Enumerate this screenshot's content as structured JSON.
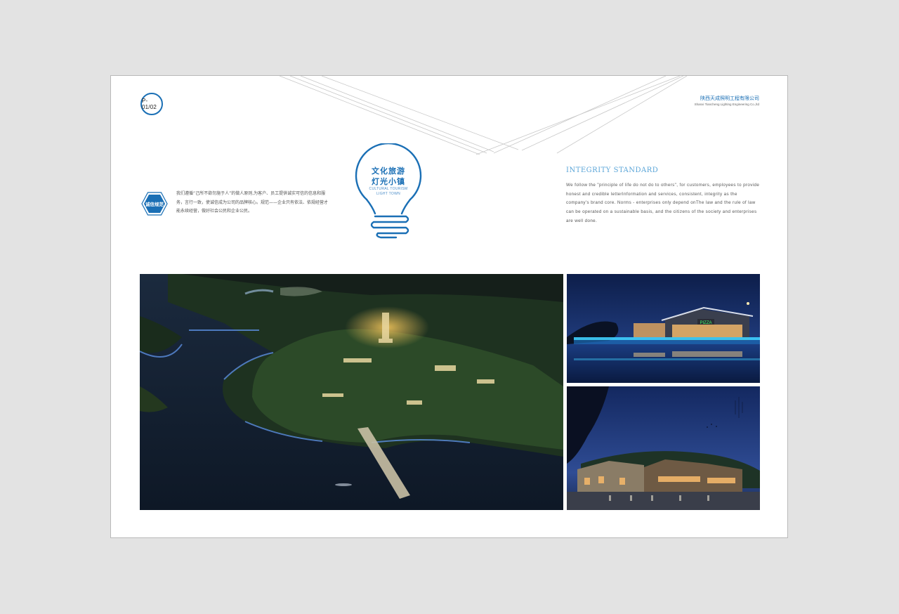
{
  "page_number": "P-01/02",
  "company": {
    "name_cn": "陕西天成照明工程有限公司",
    "name_en": "Shanxi Tiancheng Lighting Engineering Co.,ltd"
  },
  "logo": {
    "title_line1": "文化旅游",
    "title_line2": "灯光小镇",
    "subtitle_line1": "CULTURAL TOURISM",
    "subtitle_line2": "LIGHT TOWN",
    "icon": "lightbulb-icon"
  },
  "integrity_badge": {
    "label": "诚信规范",
    "color": "#1a6fb5"
  },
  "cn_paragraph": "我们遵循“己所不欲勿施于人”的做人原则,为客户、员工提供诚实可信的信息和服务，言行一致，使诚信成为公司的品牌核心。规范——企业只有依法、依规经营才能永续经营，做好社会公民和企业公民。",
  "integrity": {
    "title": "INTEGRITY STANDARD",
    "paragraph": "We follow the \"principle of life do not do to others\", for customers, employees to provide honest and credible letterInformation and services, consistent, integrity as the company's brand core. Norms - enterprises only depend onThe law and the rule of law can be operated on a sustainable basis, and the citizens of the society and enterprises are well done."
  },
  "photos": {
    "main": "aerial-night-lake-town-photo",
    "top_right": "lakeside-restaurant-night-photo",
    "top_right_sign": "PIZZA",
    "bottom_right": "ancient-building-night-photo"
  },
  "colors": {
    "accent": "#1a6fb5",
    "accent_light": "#5aa5d8",
    "background": "#e3e3e3"
  }
}
